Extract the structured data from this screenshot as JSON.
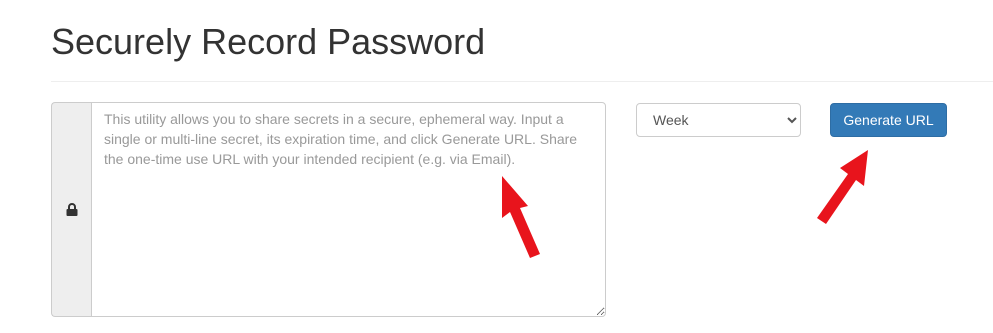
{
  "page": {
    "title": "Securely Record Password"
  },
  "form": {
    "secret_placeholder": "This utility allows you to share secrets in a secure, ephemeral way. Input a single or multi-line secret, its expiration time, and click Generate URL. Share the one-time use URL with your intended recipient (e.g. via Email).",
    "secret_value": "",
    "addon_icon": "lock-icon",
    "expiry": {
      "selected": "Week",
      "options": [
        "Week"
      ]
    },
    "generate_label": "Generate URL"
  },
  "annotations": {
    "arrow_color": "#e8141c",
    "icon": "red-arrow-icon"
  },
  "colors": {
    "button_bg": "#337ab7",
    "button_border": "#2e6da4",
    "title_text": "#333333"
  }
}
